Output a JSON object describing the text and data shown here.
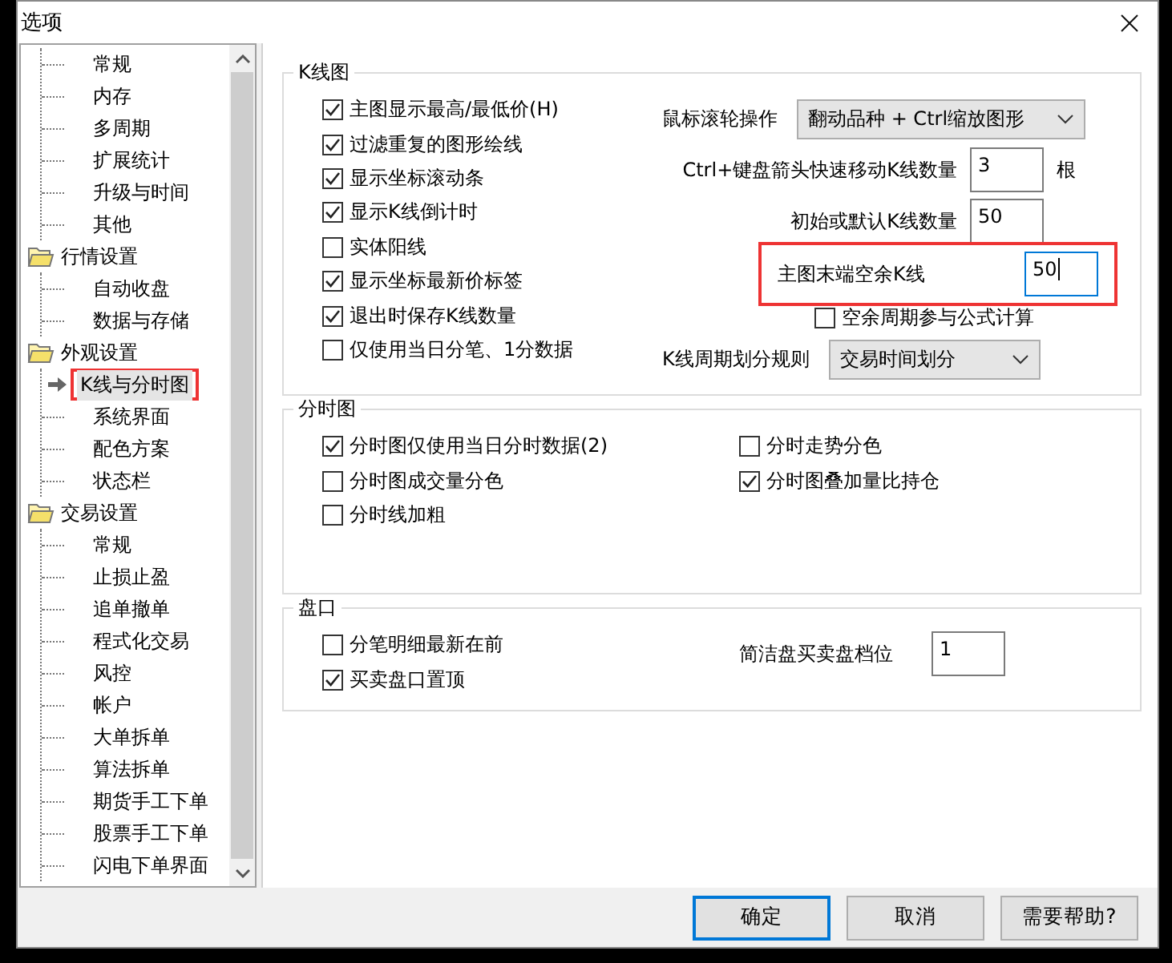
{
  "window": {
    "title": "选项"
  },
  "tree": [
    {
      "children": [
        {
          "label": "常规",
          "selected": false,
          "highlighted": false
        },
        {
          "label": "内存",
          "selected": false,
          "highlighted": false
        },
        {
          "label": "多周期",
          "selected": false,
          "highlighted": false
        },
        {
          "label": "扩展统计",
          "selected": false,
          "highlighted": false
        },
        {
          "label": "升级与时间",
          "selected": false,
          "highlighted": false
        },
        {
          "label": "其他",
          "selected": false,
          "highlighted": false
        }
      ]
    },
    {
      "label": "行情设置",
      "children": [
        {
          "label": "自动收盘",
          "selected": false,
          "highlighted": false
        },
        {
          "label": "数据与存储",
          "selected": false,
          "highlighted": false
        }
      ]
    },
    {
      "label": "外观设置",
      "children": [
        {
          "label": "K线与分时图",
          "selected": true,
          "highlighted": true
        },
        {
          "label": "系统界面",
          "selected": false,
          "highlighted": false
        },
        {
          "label": "配色方案",
          "selected": false,
          "highlighted": false
        },
        {
          "label": "状态栏",
          "selected": false,
          "highlighted": false
        }
      ]
    },
    {
      "label": "交易设置",
      "children": [
        {
          "label": "常规",
          "selected": false,
          "highlighted": false
        },
        {
          "label": "止损止盈",
          "selected": false,
          "highlighted": false
        },
        {
          "label": "追单撤单",
          "selected": false,
          "highlighted": false
        },
        {
          "label": "程式化交易",
          "selected": false,
          "highlighted": false
        },
        {
          "label": "风控",
          "selected": false,
          "highlighted": false
        },
        {
          "label": "帐户",
          "selected": false,
          "highlighted": false
        },
        {
          "label": "大单拆单",
          "selected": false,
          "highlighted": false
        },
        {
          "label": "算法拆单",
          "selected": false,
          "highlighted": false
        },
        {
          "label": "期货手工下单",
          "selected": false,
          "highlighted": false
        },
        {
          "label": "股票手工下单",
          "selected": false,
          "highlighted": false
        },
        {
          "label": "闪电下单界面",
          "selected": false,
          "highlighted": false
        }
      ]
    }
  ],
  "kline": {
    "title": "K线图",
    "options": [
      {
        "label": "主图显示最高/最低价(H)",
        "checked": true
      },
      {
        "label": "过滤重复的图形绘线",
        "checked": true
      },
      {
        "label": "显示坐标滚动条",
        "checked": true
      },
      {
        "label": "显示K线倒计时",
        "checked": true
      },
      {
        "label": "实体阳线",
        "checked": false
      },
      {
        "label": "显示坐标最新价标签",
        "checked": true
      },
      {
        "label": "退出时保存K线数量",
        "checked": true
      },
      {
        "label": "仅使用当日分笔、1分数据",
        "checked": false
      }
    ],
    "settings": [
      {
        "kind": "select",
        "label": "鼠标滚轮操作",
        "value": "翻动品种 + Ctrl缩放图形"
      },
      {
        "kind": "field",
        "label": "Ctrl+键盘箭头快速移动K线数量",
        "value": "3",
        "unit": "根",
        "focused": false,
        "highlighted": false
      },
      {
        "kind": "field",
        "label": "初始或默认K线数量",
        "value": "50",
        "focused": false,
        "highlighted": false
      },
      {
        "kind": "field",
        "label": "主图末端空余K线",
        "value": "50",
        "focused": true,
        "highlighted": true
      },
      {
        "kind": "checkbox",
        "label": "空余周期参与公式计算",
        "checked": false
      },
      {
        "kind": "select",
        "label": "K线周期划分规则",
        "value": "交易时间划分"
      }
    ]
  },
  "timeshare": {
    "title": "分时图",
    "options": [
      {
        "label": "分时图仅使用当日分时数据(2)",
        "checked": true
      },
      {
        "label": "分时图成交量分色",
        "checked": false
      },
      {
        "label": "分时线加粗",
        "checked": false
      },
      {
        "label": "分时走势分色",
        "checked": false
      },
      {
        "label": "分时图叠加量比持仓",
        "checked": true
      }
    ]
  },
  "depth": {
    "title": "盘口",
    "options": [
      {
        "label": "分笔明细最新在前",
        "checked": false
      },
      {
        "label": "买卖盘口置顶",
        "checked": true
      }
    ],
    "settings": [
      {
        "label": "简洁盘买卖盘档位",
        "value": "1"
      }
    ]
  },
  "buttons": [
    {
      "label": "确定",
      "default": true
    },
    {
      "label": "取消",
      "default": false
    },
    {
      "label": "需要帮助?",
      "default": false
    }
  ]
}
